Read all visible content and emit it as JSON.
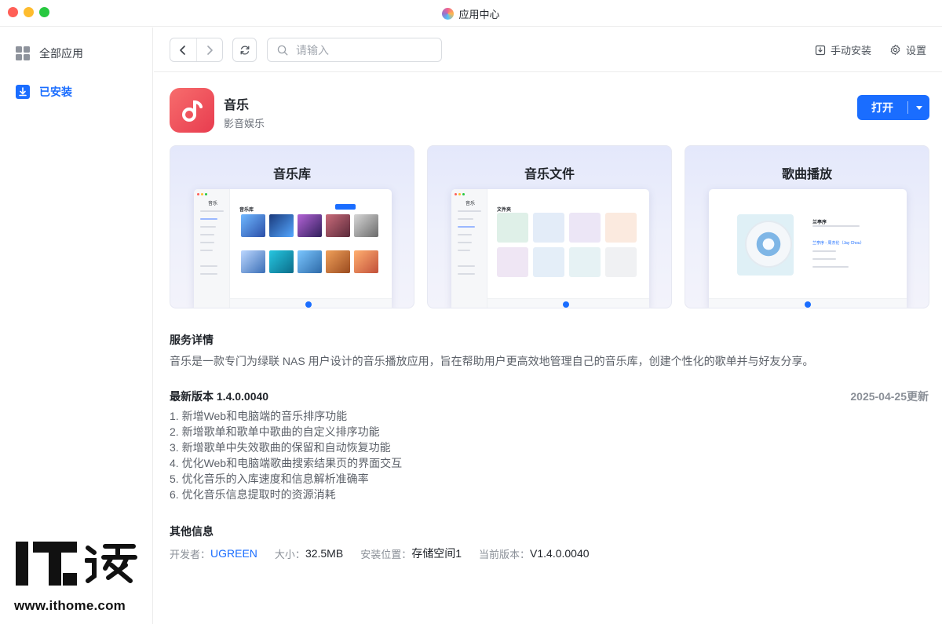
{
  "window": {
    "title": "应用中心"
  },
  "sidebar": {
    "items": [
      {
        "label": "全部应用",
        "icon": "grid-icon",
        "active": false
      },
      {
        "label": "已安装",
        "icon": "download-icon",
        "active": true
      }
    ]
  },
  "toolbar": {
    "search_placeholder": "请输入",
    "manual_install": "手动安装",
    "settings": "设置"
  },
  "app": {
    "name": "音乐",
    "category": "影音娱乐",
    "open_label": "打开",
    "accent": "#1a6dff"
  },
  "screenshots": [
    {
      "title": "音乐库",
      "mini_app": "音乐",
      "mini_header": "音乐库"
    },
    {
      "title": "音乐文件",
      "mini_app": "音乐",
      "mini_header": "文件夹"
    },
    {
      "title": "歌曲播放",
      "mini_song": "兰亭序",
      "mini_line": "兰亭序 - 周杰伦（Jay Chou）"
    }
  ],
  "details": {
    "service_title": "服务详情",
    "service_desc": "音乐是一款专门为绿联 NAS 用户设计的音乐播放应用，旨在帮助用户更高效地管理自己的音乐库，创建个性化的歌单并与好友分享。",
    "version_title": "最新版本 1.4.0.0040",
    "update_date": "2025-04-25更新",
    "notes": [
      "1. 新增Web和电脑端的音乐排序功能",
      "2. 新增歌单和歌单中歌曲的自定义排序功能",
      "3. 新增歌单中失效歌曲的保留和自动恢复功能",
      "4. 优化Web和电脑端歌曲搜索结果页的界面交互",
      "5. 优化音乐的入库速度和信息解析准确率",
      "6. 优化音乐信息提取时的资源消耗"
    ],
    "other_title": "其他信息",
    "info": {
      "developer_label": "开发者：",
      "developer": "UGREEN",
      "size_label": "大小：",
      "size": "32.5MB",
      "location_label": "安装位置：",
      "location": "存储空间1",
      "version_label": "当前版本：",
      "version": "V1.4.0.0040"
    }
  },
  "watermark": {
    "text": "IT之家",
    "url": "www.ithome.com"
  }
}
